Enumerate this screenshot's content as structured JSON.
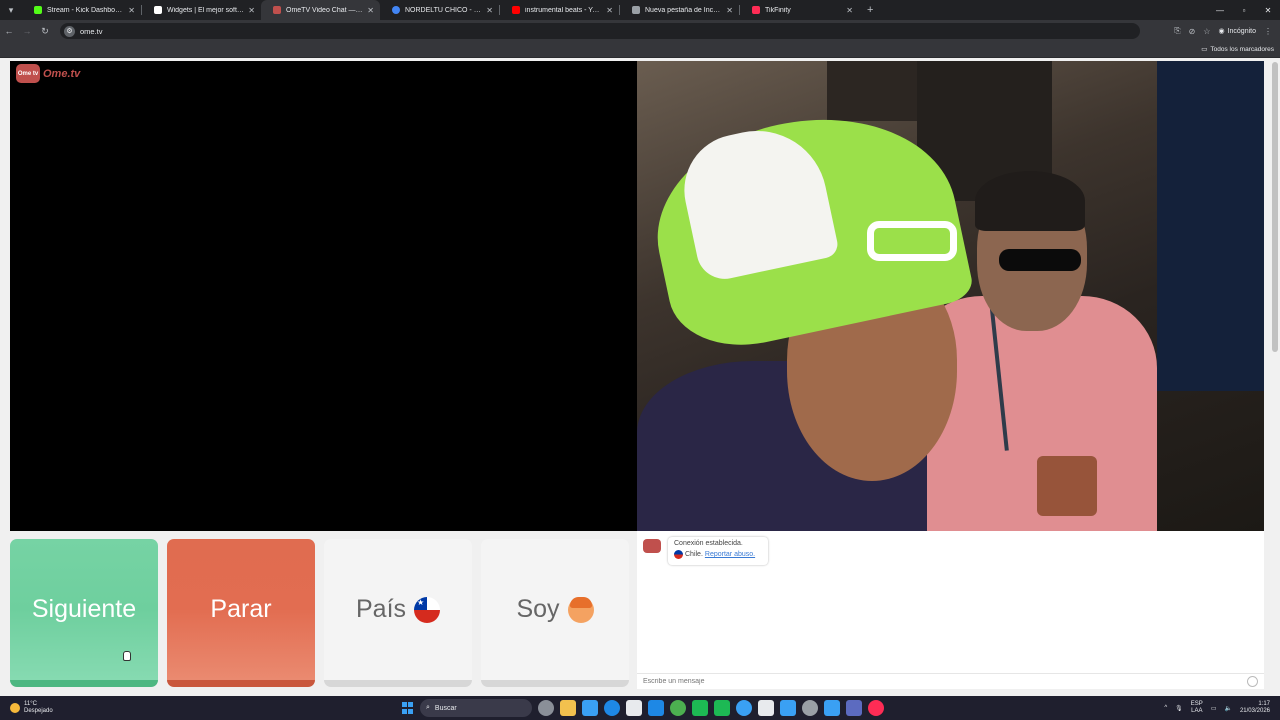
{
  "browser": {
    "tabs": [
      {
        "title": "Stream - Kick Dashboard",
        "favicon_color": "#53fc18"
      },
      {
        "title": "Widgets | El mejor software pa",
        "favicon_color": "#ffffff"
      },
      {
        "title": "OmeTV Video Chat — Ome",
        "favicon_color": "#c0504d",
        "active": true
      },
      {
        "title": "NORDELTU CHICO - Buscar con",
        "favicon_color": "#4285f4"
      },
      {
        "title": "instrumental beats - YouTube",
        "favicon_color": "#ff0000"
      },
      {
        "title": "Nueva pestaña de Incógnito",
        "favicon_color": "#9aa0a6"
      },
      {
        "title": "TikFinity",
        "favicon_color": "#fe2c55"
      }
    ],
    "tab_close": "✕",
    "new_tab": "+",
    "url": "ome.tv",
    "incognito_label": "Incógnito",
    "bookmarks_all": "Todos los marcadores"
  },
  "page": {
    "logo_text": "Ome.tv",
    "logo_badge": "Ome tv",
    "buttons": {
      "next": "Siguiente",
      "stop": "Parar",
      "country": "País",
      "soy": "Soy"
    },
    "chat": {
      "status_line1": "Conexión establecida.",
      "country": "Chile.",
      "report_link": "Reportar abuso.",
      "input_placeholder": "Escribe un mensaje"
    }
  },
  "taskbar": {
    "weather_temp": "11°C",
    "weather_desc": "Despejado",
    "search_label": "Buscar",
    "lang_top": "ESP",
    "lang_bottom": "LAA",
    "time": "1:17",
    "date": "21/03/2026",
    "icon_colors": [
      "#8a8f98",
      "#f2c14e",
      "#3aa0f3",
      "#1e88e5",
      "#e8eaed",
      "#1e88e5",
      "#4caf50",
      "#1db954",
      "#1db954",
      "#3aa0f3",
      "#e8eaed",
      "#3aa0f3",
      "#9aa0a6",
      "#3aa0f3",
      "#5c6bc0",
      "#fe2c55"
    ]
  }
}
